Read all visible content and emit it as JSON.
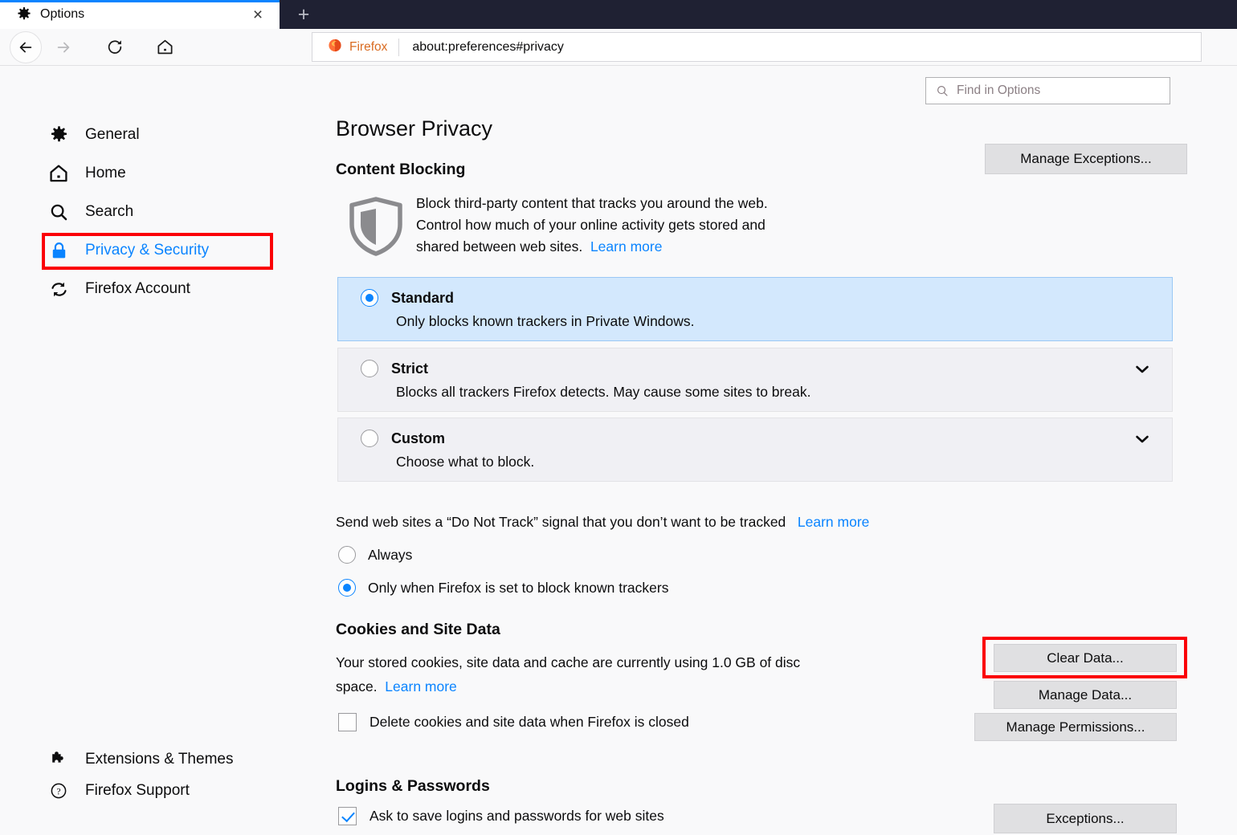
{
  "window": {
    "tab_title": "Options",
    "tab_icon": "gear-icon",
    "close_label": "×",
    "new_tab_label": "+"
  },
  "toolbar": {
    "back": "back-arrow-icon",
    "forward": "forward-arrow-icon",
    "reload": "reload-icon",
    "home": "home-icon",
    "identity_label": "Firefox",
    "url": "about:preferences#privacy"
  },
  "search": {
    "placeholder": "Find in Options",
    "icon": "search-icon"
  },
  "sidebar": {
    "items": [
      {
        "label": "General",
        "icon": "gear-icon",
        "selected": false
      },
      {
        "label": "Home",
        "icon": "home-icon",
        "selected": false
      },
      {
        "label": "Search",
        "icon": "search-icon",
        "selected": false
      },
      {
        "label": "Privacy & Security",
        "icon": "lock-icon",
        "selected": true
      },
      {
        "label": "Firefox Account",
        "icon": "sync-icon",
        "selected": false
      }
    ],
    "footer_items": [
      {
        "label": "Extensions & Themes",
        "icon": "puzzle-icon"
      },
      {
        "label": "Firefox Support",
        "icon": "question-circle-icon"
      }
    ]
  },
  "main": {
    "page_title": "Browser Privacy",
    "content_blocking": {
      "heading": "Content Blocking",
      "icon": "shield-icon",
      "description_line1": "Block third-party content that tracks you around the web.",
      "description_line2": "Control how much of your online activity gets stored and",
      "description_line3": "shared between web sites.",
      "learn_more": "Learn more",
      "manage_exceptions_button": "Manage Exceptions...",
      "manage_exceptions_accesskey": "x",
      "options": [
        {
          "name": "Standard",
          "accesskey": "d",
          "description": "Only blocks known trackers in Private Windows.",
          "selected": true,
          "expandable": false
        },
        {
          "name": "Strict",
          "accesskey": "r",
          "description": "Blocks all trackers Firefox detects. May cause some sites to break.",
          "selected": false,
          "expandable": true
        },
        {
          "name": "Custom",
          "accesskey": "C",
          "description": "Choose what to block.",
          "selected": false,
          "expandable": true
        }
      ]
    },
    "do_not_track": {
      "label": "Send web sites a “Do Not Track” signal that you don’t want to be tracked",
      "learn_more": "Learn more",
      "options": [
        {
          "label": "Always",
          "selected": false
        },
        {
          "label": "Only when Firefox is set to block known trackers",
          "selected": true
        }
      ]
    },
    "cookies": {
      "heading": "Cookies and Site Data",
      "description_line1": "Your stored cookies, site data and cache are currently using 1.0 GB of disc",
      "description_line2": "space.",
      "storage_used": "1.0 GB",
      "learn_more": "Learn more",
      "delete_on_close_label": "Delete cookies and site data when Firefox is closed",
      "delete_on_close_accesskey": "c",
      "delete_on_close_checked": false,
      "clear_data_button": "Clear Data...",
      "clear_data_accesskey": "l",
      "manage_data_button": "Manage Data...",
      "manage_data_accesskey": "M",
      "manage_permissions_button": "Manage Permissions...",
      "manage_permissions_accesskey": "P"
    },
    "logins": {
      "heading": "Logins & Passwords",
      "ask_to_save_label": "Ask to save logins and passwords for web sites",
      "ask_to_save_accesskey": "r",
      "ask_to_save_checked": true,
      "exceptions_button": "Exceptions...",
      "exceptions_accesskey": "x"
    }
  },
  "highlights": {
    "color": "#fb0007",
    "targets": [
      "sidebar-item-privacy-security",
      "clear-data-button"
    ]
  },
  "colors": {
    "accent_blue": "#0a84ff",
    "tabstrip_bg": "#1f2133",
    "page_bg": "#f9f9fa",
    "selected_card_bg": "#d3e8fd",
    "card_bg": "#f0f0f4",
    "button_bg": "#e0e0e2",
    "firefox_orange": "#d96b21"
  }
}
